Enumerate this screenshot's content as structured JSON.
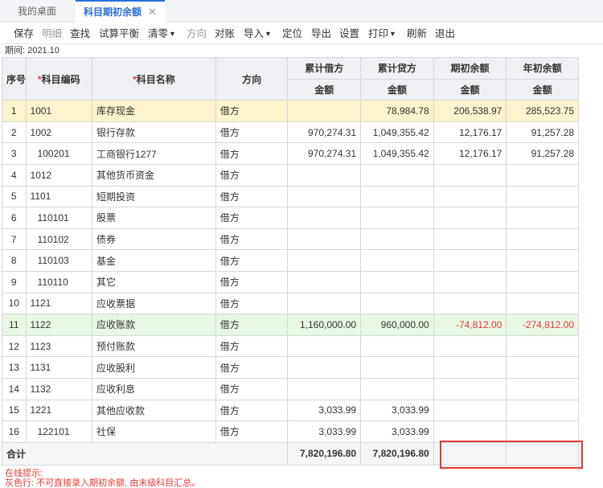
{
  "tabs": [
    {
      "label": "我的桌面"
    },
    {
      "label": "科目期初余额",
      "active": true
    }
  ],
  "toolbar": {
    "save": "保存",
    "detail": "明细",
    "find": "查找",
    "trial_balance": "试算平衡",
    "clear": "清零",
    "direction": "方向",
    "reconcile": "对账",
    "import": "导入",
    "locate": "定位",
    "export": "导出",
    "settings": "设置",
    "print": "打印",
    "refresh": "刷新",
    "exit": "退出"
  },
  "period_label": "期间: 2021.10",
  "table": {
    "headers": {
      "seq": "序号",
      "code": "科目编码",
      "name": "科目名称",
      "direction": "方向",
      "debit": "累计借方",
      "credit": "累计贷方",
      "opening": "期初余额",
      "year_start": "年初余额",
      "amount": "金额",
      "required_mark": "*"
    },
    "rows": [
      {
        "seq": "1",
        "code": "1001",
        "name": "库存现金",
        "dir": "借方",
        "debit": "",
        "credit": "78,984.78",
        "opening": "206,538.97",
        "year": "285,523.75"
      },
      {
        "seq": "2",
        "code": "1002",
        "name": "银行存款",
        "dir": "借方",
        "debit": "970,274.31",
        "credit": "1,049,355.42",
        "opening": "12,176.17",
        "year": "91,257.28"
      },
      {
        "seq": "3",
        "code": "100201",
        "name": "工商银行1277",
        "dir": "借方",
        "debit": "970,274.31",
        "credit": "1,049,355.42",
        "opening": "12,176.17",
        "year": "91,257.28"
      },
      {
        "seq": "4",
        "code": "1012",
        "name": "其他货币资金",
        "dir": "借方",
        "debit": "",
        "credit": "",
        "opening": "",
        "year": ""
      },
      {
        "seq": "5",
        "code": "1101",
        "name": "短期投资",
        "dir": "借方",
        "debit": "",
        "credit": "",
        "opening": "",
        "year": ""
      },
      {
        "seq": "6",
        "code": "110101",
        "name": "股票",
        "dir": "借方",
        "debit": "",
        "credit": "",
        "opening": "",
        "year": ""
      },
      {
        "seq": "7",
        "code": "110102",
        "name": "债券",
        "dir": "借方",
        "debit": "",
        "credit": "",
        "opening": "",
        "year": ""
      },
      {
        "seq": "8",
        "code": "110103",
        "name": "基金",
        "dir": "借方",
        "debit": "",
        "credit": "",
        "opening": "",
        "year": ""
      },
      {
        "seq": "9",
        "code": "110110",
        "name": "其它",
        "dir": "借方",
        "debit": "",
        "credit": "",
        "opening": "",
        "year": ""
      },
      {
        "seq": "10",
        "code": "1121",
        "name": "应收票据",
        "dir": "借方",
        "debit": "",
        "credit": "",
        "opening": "",
        "year": ""
      },
      {
        "seq": "11",
        "code": "1122",
        "name": "应收账款",
        "dir": "借方",
        "debit": "1,160,000.00",
        "credit": "960,000.00",
        "opening": "-74,812.00",
        "year": "-274,812.00"
      },
      {
        "seq": "12",
        "code": "1123",
        "name": "预付账款",
        "dir": "借方",
        "debit": "",
        "credit": "",
        "opening": "",
        "year": ""
      },
      {
        "seq": "13",
        "code": "1131",
        "name": "应收股利",
        "dir": "借方",
        "debit": "",
        "credit": "",
        "opening": "",
        "year": ""
      },
      {
        "seq": "14",
        "code": "1132",
        "name": "应收利息",
        "dir": "借方",
        "debit": "",
        "credit": "",
        "opening": "",
        "year": ""
      },
      {
        "seq": "15",
        "code": "1221",
        "name": "其他应收款",
        "dir": "借方",
        "debit": "3,033.99",
        "credit": "3,033.99",
        "opening": "",
        "year": ""
      },
      {
        "seq": "16",
        "code": "122101",
        "name": "社保",
        "dir": "借方",
        "debit": "3,033.99",
        "credit": "3,033.99",
        "opening": "",
        "year": ""
      }
    ],
    "total": {
      "label": "合计",
      "debit": "7,820,196.80",
      "credit": "7,820,196.80",
      "opening": "",
      "year": ""
    }
  },
  "hint": {
    "title": "在线提示:",
    "text": "灰色行:  不可直接录入期初余额, 由末级科目汇总。"
  },
  "colors": {
    "accent": "#2b6fd6",
    "negative": "#e53935",
    "selected_row": "#fdf3cc",
    "highlight_row": "#e8f7e3"
  }
}
